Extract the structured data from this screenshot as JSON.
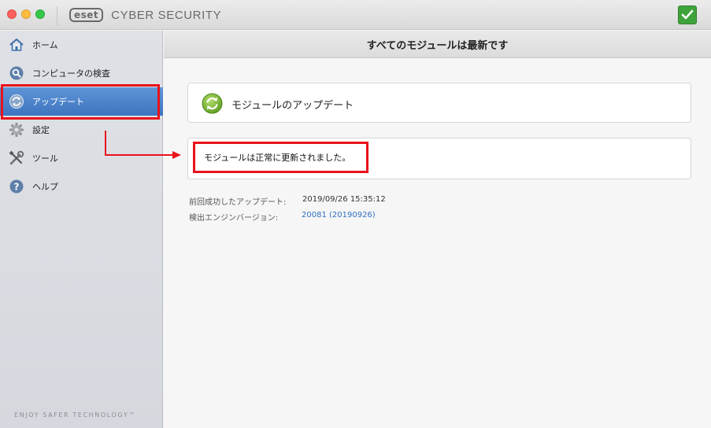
{
  "window": {
    "brand": "eset",
    "product": "CYBER SECURITY"
  },
  "sidebar": {
    "items": [
      {
        "label": "ホーム",
        "icon": "home-icon"
      },
      {
        "label": "コンピュータの検査",
        "icon": "magnifier-icon"
      },
      {
        "label": "アップデート",
        "icon": "refresh-icon",
        "active": true
      },
      {
        "label": "設定",
        "icon": "gear-icon"
      },
      {
        "label": "ツール",
        "icon": "tools-icon"
      },
      {
        "label": "ヘルプ",
        "icon": "help-icon"
      }
    ],
    "tagline": "ENJOY SAFER TECHNOLOGY™"
  },
  "main": {
    "header": "すべてのモジュールは最新です",
    "update_card_title": "モジュールのアップデート",
    "result_message": "モジュールは正常に更新されました。",
    "info": [
      {
        "label": "前回成功したアップデート:",
        "value": "2019/09/26 15:35:12"
      },
      {
        "label": "検出エンジンバージョン:",
        "value": "20081 (20190926)"
      }
    ]
  },
  "colors": {
    "accent": "#3d74c0",
    "annotation": "#e8131b",
    "status_ok": "#3fa33b",
    "link": "#2f6fc0"
  }
}
